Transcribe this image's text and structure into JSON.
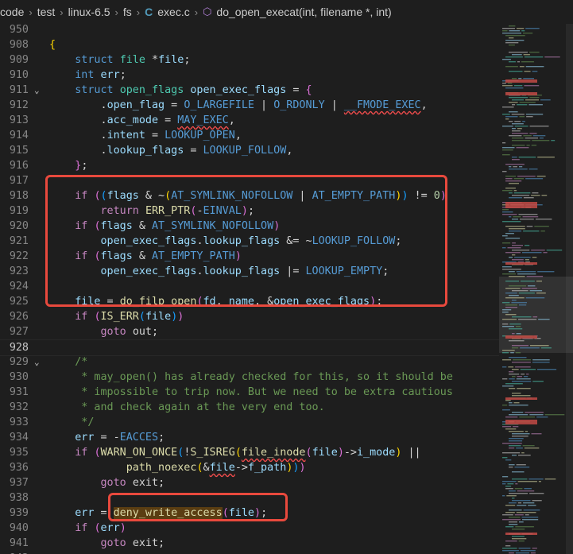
{
  "breadcrumb": {
    "items": [
      "code",
      "test",
      "linux-6.5",
      "fs"
    ],
    "file": "exec.c",
    "file_icon": "C",
    "symbol": "do_open_execat(int, filename *, int)"
  },
  "colors": {
    "accent_red": "#e8493d",
    "editor_bg": "#1e1e1e"
  },
  "editor": {
    "lines": [
      {
        "n": "950",
        "html": ""
      },
      {
        "n": "908",
        "html": "<span class=\"br1\">{</span>"
      },
      {
        "n": "909",
        "html": "    <span class=\"kw\">struct</span> <span class=\"ty\">file</span> *<span class=\"var\">file</span>;"
      },
      {
        "n": "910",
        "html": "    <span class=\"kw\">int</span> <span class=\"var\">err</span>;"
      },
      {
        "n": "911",
        "fold": true,
        "html": "    <span class=\"kw\">struct</span> <span class=\"ty\">open_flags</span> <span class=\"var\">open_exec_flags</span> = <span class=\"br2\">{</span>"
      },
      {
        "n": "912",
        "html": "        .<span class=\"var\">open_flag</span> = <span class=\"mac\">O_LARGEFILE</span> | <span class=\"mac\">O_RDONLY</span> | <span class=\"mac squig\">__FMODE_EXEC</span>,"
      },
      {
        "n": "913",
        "html": "        .<span class=\"var\">acc_mode</span> = <span class=\"mac squig\">MAY_EXEC</span>,"
      },
      {
        "n": "914",
        "html": "        .<span class=\"var\">intent</span> = <span class=\"mac\">LOOKUP_OPEN</span>,"
      },
      {
        "n": "915",
        "html": "        .<span class=\"var\">lookup_flags</span> = <span class=\"mac\">LOOKUP_FOLLOW</span>,"
      },
      {
        "n": "916",
        "html": "    <span class=\"br2\">}</span>;"
      },
      {
        "n": "917",
        "html": ""
      },
      {
        "n": "918",
        "html": "    <span class=\"ctl\">if</span> <span class=\"br2\">(</span><span class=\"br3\">(</span><span class=\"var\">flags</span> &amp; ~<span class=\"br1\">(</span><span class=\"mac\">AT_SYMLINK_NOFOLLOW</span> | <span class=\"mac\">AT_EMPTY_PATH</span><span class=\"br1\">)</span><span class=\"br3\">)</span> != <span class=\"num\">0</span><span class=\"br2\">)</span>"
      },
      {
        "n": "919",
        "html": "        <span class=\"ctl\">return</span> <span class=\"fn\">ERR_PTR</span><span class=\"br2\">(</span>-<span class=\"mac\">EINVAL</span><span class=\"br2\">)</span>;"
      },
      {
        "n": "920",
        "html": "    <span class=\"ctl\">if</span> <span class=\"br2\">(</span><span class=\"var\">flags</span> &amp; <span class=\"mac\">AT_SYMLINK_NOFOLLOW</span><span class=\"br2\">)</span>"
      },
      {
        "n": "921",
        "html": "        <span class=\"var\">open_exec_flags</span>.<span class=\"var\">lookup_flags</span> &amp;= ~<span class=\"mac\">LOOKUP_FOLLOW</span>;"
      },
      {
        "n": "922",
        "html": "    <span class=\"ctl\">if</span> <span class=\"br2\">(</span><span class=\"var\">flags</span> &amp; <span class=\"mac\">AT_EMPTY_PATH</span><span class=\"br2\">)</span>"
      },
      {
        "n": "923",
        "html": "        <span class=\"var\">open_exec_flags</span>.<span class=\"var\">lookup_flags</span> |= <span class=\"mac\">LOOKUP_EMPTY</span>;"
      },
      {
        "n": "924",
        "html": ""
      },
      {
        "n": "925",
        "html": "    <span class=\"var\">file</span> = <span class=\"fn\">do_filp_open</span><span class=\"br2\">(</span><span class=\"var\">fd</span>, <span class=\"var\">name</span>, &amp;<span class=\"var\">open_exec_flags</span><span class=\"br2\">)</span>;"
      },
      {
        "n": "926",
        "html": "    <span class=\"ctl\">if</span> <span class=\"br2\">(</span><span class=\"fn\">IS_ERR</span><span class=\"br3\">(</span><span class=\"var\">file</span><span class=\"br3\">)</span><span class=\"br2\">)</span>"
      },
      {
        "n": "927",
        "html": "        <span class=\"ctl\">goto</span> <span class=\"op\">out</span>;"
      },
      {
        "n": "928",
        "current": true,
        "html": ""
      },
      {
        "n": "929",
        "fold": true,
        "html": "    <span class=\"cm\">/*</span>"
      },
      {
        "n": "930",
        "html": "<span class=\"cm\">     * may_open() has already checked for this, so it should be</span>"
      },
      {
        "n": "931",
        "html": "<span class=\"cm\">     * impossible to trip now. But we need to be extra cautious</span>"
      },
      {
        "n": "932",
        "html": "<span class=\"cm\">     * and check again at the very end too.</span>"
      },
      {
        "n": "933",
        "html": "<span class=\"cm\">     */</span>"
      },
      {
        "n": "934",
        "html": "    <span class=\"var\">err</span> = -<span class=\"mac\">EACCES</span>;"
      },
      {
        "n": "935",
        "html": "    <span class=\"ctl\">if</span> <span class=\"br2\">(</span><span class=\"fn\">WARN_ON_ONCE</span><span class=\"br3\">(</span>!<span class=\"fn\">S_ISREG</span><span class=\"br1\">(</span><span class=\"fn squig\">file_inode</span><span class=\"br2\">(</span><span class=\"var\">file</span><span class=\"br2\">)</span>-&gt;<span class=\"var\">i_mode</span><span class=\"br1\">)</span> ||"
      },
      {
        "n": "936",
        "html": "            <span class=\"fn\">path_noexec</span><span class=\"br1\">(</span>&amp;<span class=\"var squig\">file</span>-&gt;<span class=\"var\">f_path</span><span class=\"br1\">)</span><span class=\"br3\">)</span><span class=\"br2\">)</span>"
      },
      {
        "n": "937",
        "html": "        <span class=\"ctl\">goto</span> <span class=\"op\">exit</span>;"
      },
      {
        "n": "938",
        "html": ""
      },
      {
        "n": "939",
        "html": "    <span class=\"var\">err</span> = <span class=\"fn hl\">deny_write_access</span><span class=\"br2\">(</span><span class=\"var\">file</span><span class=\"br2\">)</span>;"
      },
      {
        "n": "940",
        "html": "    <span class=\"ctl\">if</span> <span class=\"br2\">(</span><span class=\"var\">err</span><span class=\"br2\">)</span>"
      },
      {
        "n": "941",
        "html": "        <span class=\"ctl\">goto</span> <span class=\"op\">exit</span>;"
      },
      {
        "n": "942",
        "html": ""
      }
    ]
  }
}
